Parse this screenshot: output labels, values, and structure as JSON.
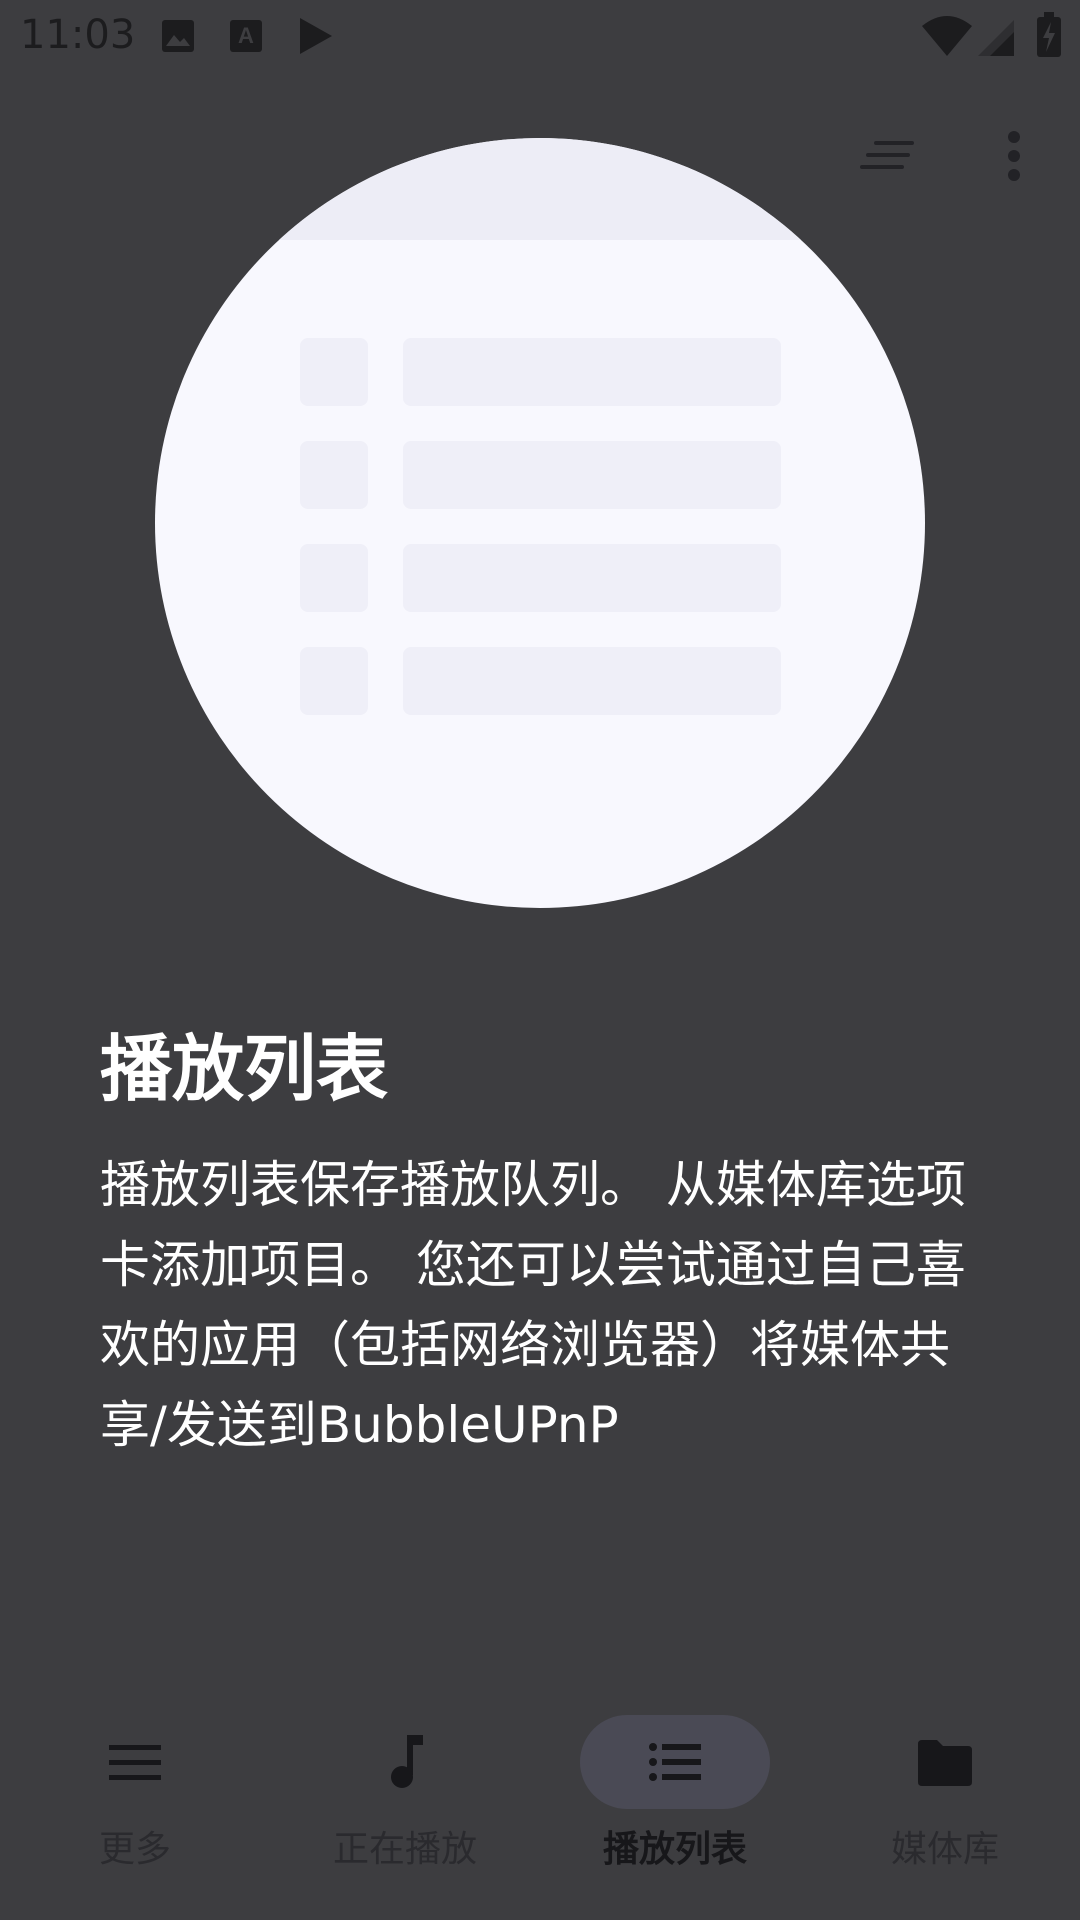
{
  "status_bar": {
    "time": "11:03",
    "icons": [
      "image-icon",
      "font-a-icon",
      "play-icon",
      "wifi-icon",
      "signal-icon",
      "battery-charging-icon"
    ]
  },
  "toolbar": {
    "icons": [
      "sort-icon",
      "more-vert-icon"
    ]
  },
  "content": {
    "title": "播放列表",
    "description": "播放列表保存播放队列。 从媒体库选项卡添加项目。 您还可以尝试通过自己喜欢的应用（包括网络浏览器）将媒体共享/发送到BubbleUPnP"
  },
  "bottom_nav": {
    "active_index": 2,
    "items": [
      {
        "label": "更多",
        "icon": "menu-icon"
      },
      {
        "label": "正在播放",
        "icon": "music-note-icon"
      },
      {
        "label": "播放列表",
        "icon": "playlist-icon"
      },
      {
        "label": "媒体库",
        "icon": "folder-icon"
      }
    ]
  },
  "colors": {
    "background": "#3d3d40",
    "illustration": "#f8f8fe",
    "text_primary": "#ffffff",
    "nav_active_pill": "#4a4a55"
  }
}
